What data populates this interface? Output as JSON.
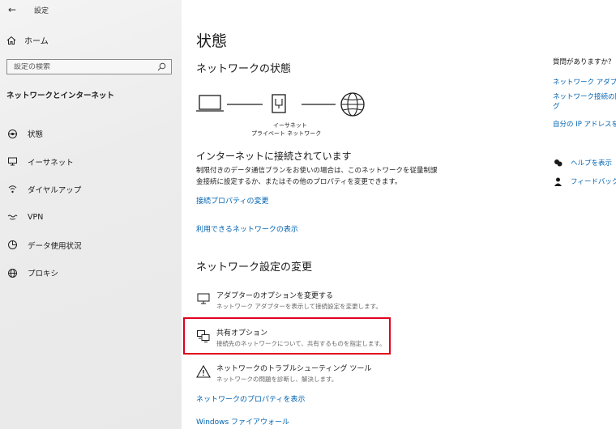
{
  "window": {
    "title": "設定",
    "back_glyph": "←"
  },
  "sidebar": {
    "home_label": "ホーム",
    "search": {
      "placeholder": "設定の検索",
      "value": ""
    },
    "section_title": "ネットワークとインターネット",
    "items": [
      {
        "label": "状態",
        "icon": "home-network-icon"
      },
      {
        "label": "イーサネット",
        "icon": "ethernet-icon"
      },
      {
        "label": "ダイヤルアップ",
        "icon": "dialup-icon"
      },
      {
        "label": "VPN",
        "icon": "vpn-icon"
      },
      {
        "label": "データ使用状況",
        "icon": "data-usage-icon"
      },
      {
        "label": "プロキシ",
        "icon": "globe-icon"
      }
    ]
  },
  "main": {
    "title": "状態",
    "network_status_heading": "ネットワークの状態",
    "diagram": {
      "label_line1": "イーサネット",
      "label_line2": "プライベート ネットワーク"
    },
    "status_heading": "インターネットに接続されています",
    "status_desc": "制限付きのデータ通信プランをお使いの場合は、このネットワークを従量制課金接続に設定するか、またはその他のプロパティを変更できます。",
    "link_properties": "接続プロパティの変更",
    "link_available": "利用できるネットワークの表示",
    "settings_heading": "ネットワーク設定の変更",
    "options": [
      {
        "title": "アダプターのオプションを変更する",
        "desc": "ネットワーク アダプターを表示して接続設定を変更します。"
      },
      {
        "title": "共有オプション",
        "desc": "接続先のネットワークについて、共有するものを指定します。"
      },
      {
        "title": "ネットワークのトラブルシューティング ツール",
        "desc": "ネットワークの問題を診断し、解決します。"
      }
    ],
    "link_network_props": "ネットワークのプロパティを表示",
    "link_firewall": "Windows ファイアウォール"
  },
  "right_panel": {
    "heading": "質問がありますか?",
    "links": [
      "ネットワーク アダプタ",
      "ネットワーク接続の問",
      "グ",
      "自分の IP アドレスを"
    ],
    "help_label": "ヘルプを表示",
    "feedback_label": "フィードバックの"
  }
}
